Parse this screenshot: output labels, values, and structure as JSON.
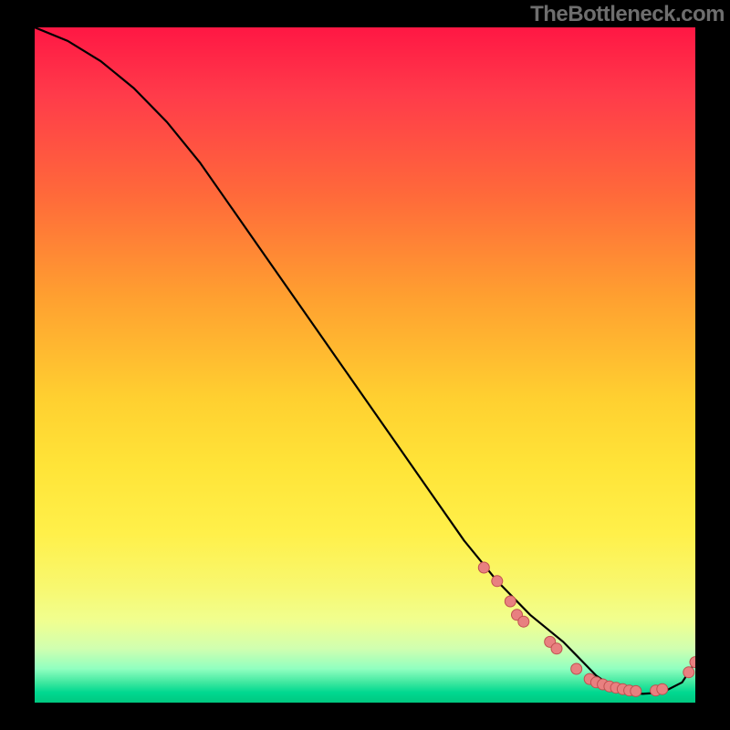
{
  "watermark": "TheBottleneck.com",
  "chart_data": {
    "type": "line",
    "title": "",
    "xlabel": "",
    "ylabel": "",
    "xlim": [
      0,
      100
    ],
    "ylim": [
      0,
      100
    ],
    "grid": false,
    "series": [
      {
        "name": "curve",
        "x": [
          0,
          5,
          10,
          15,
          20,
          25,
          30,
          35,
          40,
          45,
          50,
          55,
          60,
          65,
          70,
          75,
          80,
          82,
          85,
          88,
          90,
          92,
          95,
          98,
          100
        ],
        "y": [
          100,
          98,
          95,
          91,
          86,
          80,
          73,
          66,
          59,
          52,
          45,
          38,
          31,
          24,
          18,
          13,
          9,
          7,
          4,
          2,
          1.5,
          1.3,
          1.5,
          3,
          6
        ]
      }
    ],
    "markers": [
      {
        "x": 68,
        "y": 20
      },
      {
        "x": 70,
        "y": 18
      },
      {
        "x": 72,
        "y": 15
      },
      {
        "x": 73,
        "y": 13
      },
      {
        "x": 74,
        "y": 12
      },
      {
        "x": 78,
        "y": 9
      },
      {
        "x": 79,
        "y": 8
      },
      {
        "x": 82,
        "y": 5
      },
      {
        "x": 84,
        "y": 3.5
      },
      {
        "x": 85,
        "y": 3
      },
      {
        "x": 86,
        "y": 2.7
      },
      {
        "x": 87,
        "y": 2.4
      },
      {
        "x": 88,
        "y": 2.2
      },
      {
        "x": 89,
        "y": 2.0
      },
      {
        "x": 90,
        "y": 1.8
      },
      {
        "x": 91,
        "y": 1.7
      },
      {
        "x": 94,
        "y": 1.8
      },
      {
        "x": 95,
        "y": 2.0
      },
      {
        "x": 99,
        "y": 4.5
      },
      {
        "x": 100,
        "y": 6
      }
    ],
    "colors": {
      "line": "#000000",
      "marker_fill": "#e88080",
      "marker_stroke": "#c05050",
      "gradient_top": "#ff1744",
      "gradient_mid": "#ffe438",
      "gradient_bottom": "#00c880"
    }
  }
}
